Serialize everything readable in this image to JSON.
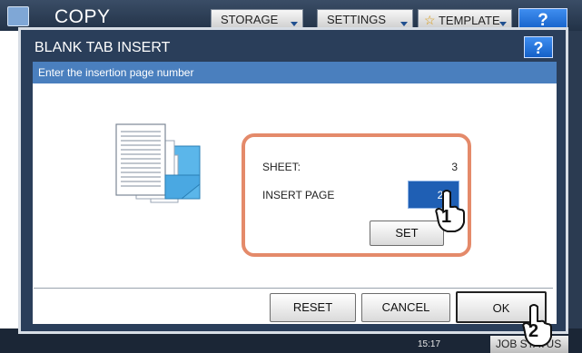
{
  "app": {
    "title": "COPY",
    "top_buttons": [
      {
        "label": "STORAGE"
      },
      {
        "label": "SETTINGS"
      },
      {
        "label": "TEMPLATE",
        "icon": "star-icon"
      }
    ],
    "help_label": "?"
  },
  "dialog": {
    "title": "BLANK TAB INSERT",
    "help_label": "?",
    "subtitle": "Enter the insertion page number",
    "sheet_label": "SHEET:",
    "sheet_value": "3",
    "insert_label": "INSERT PAGE",
    "insert_value": "25",
    "set_label": "SET",
    "reset_label": "RESET",
    "cancel_label": "CANCEL",
    "ok_label": "OK"
  },
  "callouts": [
    "1",
    "2"
  ],
  "status": {
    "time": "15:17",
    "job_status_label": "JOB STATUS"
  },
  "colors": {
    "title_bar": "#223247",
    "dialog_frame": "#2a3e5a",
    "subtitle_bar": "#4a7fbe",
    "panel_border": "#e48a6a",
    "input_field": "#1f5fb4",
    "help_button": "#1460c8"
  }
}
